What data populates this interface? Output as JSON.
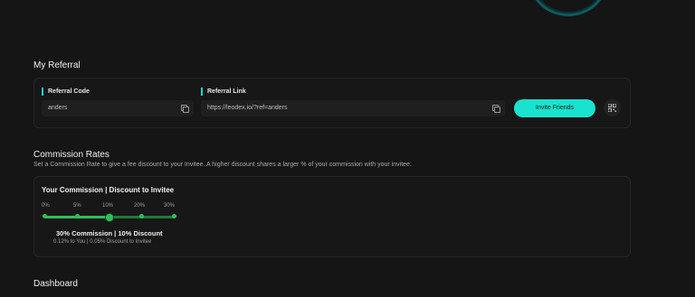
{
  "referral": {
    "title": "My Referral",
    "code_label": "Referral Code",
    "code_value": "anders",
    "link_label": "Referral Link",
    "link_value": "https://leodex.io/?ref=anders",
    "invite_label": "Invite Friends",
    "accent_color": "#19e3cf"
  },
  "commission": {
    "title": "Commission Rates",
    "description": "Set a Commission Rate to give a fee discount to your Invitee. A higher discount shares a larger % of your commission with your invitee.",
    "card_title": "Your Commission | Discount to Invitee",
    "slider_options": [
      "0%",
      "5%",
      "10%",
      "20%",
      "30%"
    ],
    "selected_option": "10%",
    "summary": "30% Commission | 10% Discount",
    "detail": "0.12% to You | 0.05% Discount to Invitee",
    "slider_color": "#2fbf5a"
  },
  "dashboard": {
    "title": "Dashboard"
  }
}
